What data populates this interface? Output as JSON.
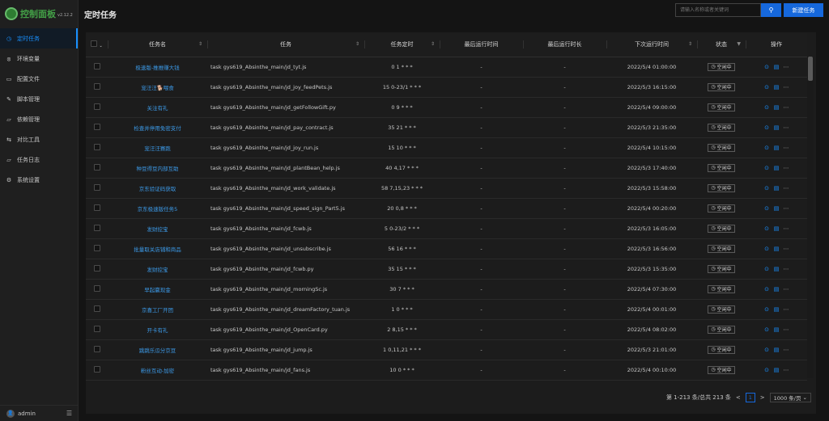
{
  "app": {
    "logo_text": "控制面板",
    "version": "v2.12.2"
  },
  "sidebar": {
    "items": [
      {
        "label": "定时任务",
        "icon": "clock-icon"
      },
      {
        "label": "环境变量",
        "icon": "variable-icon"
      },
      {
        "label": "配置文件",
        "icon": "file-icon"
      },
      {
        "label": "脚本管理",
        "icon": "edit-icon"
      },
      {
        "label": "依赖管理",
        "icon": "folder-icon"
      },
      {
        "label": "对比工具",
        "icon": "diff-icon"
      },
      {
        "label": "任务日志",
        "icon": "folder-icon"
      },
      {
        "label": "系统设置",
        "icon": "gear-icon"
      }
    ],
    "user": "admin"
  },
  "header": {
    "title": "定时任务",
    "search_placeholder": "请输入名称或者关键词",
    "new_button": "新建任务"
  },
  "table": {
    "columns": {
      "name": "任务名",
      "command": "任务",
      "schedule": "任务定时",
      "last_run": "最后运行时间",
      "last_duration": "最后运行时长",
      "next_run": "下次运行时间",
      "status": "状态",
      "actions": "操作"
    },
    "rows": [
      {
        "name": "极速版-推推赚大钱",
        "command": "task gys619_Absinthe_main/jd_tyt.js",
        "schedule": "0 1 * * *",
        "last_run": "-",
        "last_duration": "-",
        "next_run": "2022/5/4 01:00:00",
        "status": "空闲中"
      },
      {
        "name": "宠汪汪🐕喂食",
        "command": "task gys619_Absinthe_main/jd_joy_feedPets.js",
        "schedule": "15 0-23/1 * * *",
        "last_run": "-",
        "last_duration": "-",
        "next_run": "2022/5/3 16:15:00",
        "status": "空闲中"
      },
      {
        "name": "关注有礼",
        "command": "task gys619_Absinthe_main/jd_getFollowGift.py",
        "schedule": "0 9 * * *",
        "last_run": "-",
        "last_duration": "-",
        "next_run": "2022/5/4 09:00:00",
        "status": "空闲中"
      },
      {
        "name": "检查并停用免密支付",
        "command": "task gys619_Absinthe_main/jd_pay_contract.js",
        "schedule": "35 21 * * *",
        "last_run": "-",
        "last_duration": "-",
        "next_run": "2022/5/3 21:35:00",
        "status": "空闲中"
      },
      {
        "name": "宠汪汪赛跑",
        "command": "task gys619_Absinthe_main/jd_joy_run.js",
        "schedule": "15 10 * * *",
        "last_run": "-",
        "last_duration": "-",
        "next_run": "2022/5/4 10:15:00",
        "status": "空闲中"
      },
      {
        "name": "种豆得豆内部互助",
        "command": "task gys619_Absinthe_main/jd_plantBean_help.js",
        "schedule": "40 4,17 * * *",
        "last_run": "-",
        "last_duration": "-",
        "next_run": "2022/5/3 17:40:00",
        "status": "空闲中"
      },
      {
        "name": "京东验证码获取",
        "command": "task gys619_Absinthe_main/jd_work_validate.js",
        "schedule": "58 7,15,23 * * *",
        "last_run": "-",
        "last_duration": "-",
        "next_run": "2022/5/3 15:58:00",
        "status": "空闲中"
      },
      {
        "name": "京东极速版任务5",
        "command": "task gys619_Absinthe_main/jd_speed_sign_Part5.js",
        "schedule": "20 0,8 * * *",
        "last_run": "-",
        "last_duration": "-",
        "next_run": "2022/5/4 00:20:00",
        "status": "空闲中"
      },
      {
        "name": "发财挖宝",
        "command": "task gys619_Absinthe_main/jd_fcwb.js",
        "schedule": "5 0-23/2 * * *",
        "last_run": "-",
        "last_duration": "-",
        "next_run": "2022/5/3 16:05:00",
        "status": "空闲中"
      },
      {
        "name": "批量取关店铺和商品",
        "command": "task gys619_Absinthe_main/jd_unsubscribe.js",
        "schedule": "56 16 * * *",
        "last_run": "-",
        "last_duration": "-",
        "next_run": "2022/5/3 16:56:00",
        "status": "空闲中"
      },
      {
        "name": "发财挖宝",
        "command": "task gys619_Absinthe_main/jd_fcwb.py",
        "schedule": "35 15 * * *",
        "last_run": "-",
        "last_duration": "-",
        "next_run": "2022/5/3 15:35:00",
        "status": "空闲中"
      },
      {
        "name": "早起赢现金",
        "command": "task gys619_Absinthe_main/jd_morningSc.js",
        "schedule": "30 7 * * *",
        "last_run": "-",
        "last_duration": "-",
        "next_run": "2022/5/4 07:30:00",
        "status": "空闲中"
      },
      {
        "name": "京喜工厂开团",
        "command": "task gys619_Absinthe_main/jd_dreamFactory_tuan.js",
        "schedule": "1 0 * * *",
        "last_run": "-",
        "last_duration": "-",
        "next_run": "2022/5/4 00:01:00",
        "status": "空闲中"
      },
      {
        "name": "开卡有礼",
        "command": "task gys619_Absinthe_main/jd_OpenCard.py",
        "schedule": "2 8,15 * * *",
        "last_run": "-",
        "last_duration": "-",
        "next_run": "2022/5/4 08:02:00",
        "status": "空闲中"
      },
      {
        "name": "跳跳乐瓜分京豆",
        "command": "task gys619_Absinthe_main/jd_jump.js",
        "schedule": "1 0,11,21 * * *",
        "last_run": "-",
        "last_duration": "-",
        "next_run": "2022/5/3 21:01:00",
        "status": "空闲中"
      },
      {
        "name": "粉丝互动-加密",
        "command": "task gys619_Absinthe_main/jd_fans.js",
        "schedule": "10 0 * * *",
        "last_run": "-",
        "last_duration": "-",
        "next_run": "2022/5/4 00:10:00",
        "status": "空闲中"
      }
    ]
  },
  "pagination": {
    "summary": "第 1-213 条/总共 213 条",
    "prev": "<",
    "page": "1",
    "next": ">",
    "page_size": "1000 条/页"
  }
}
